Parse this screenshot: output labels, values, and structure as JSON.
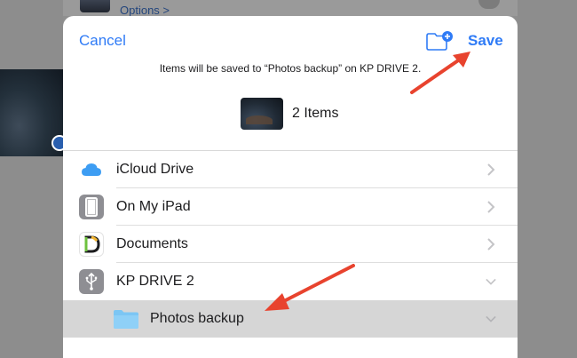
{
  "background": {
    "options_label": "Options >"
  },
  "header": {
    "cancel_label": "Cancel",
    "save_label": "Save",
    "new_folder_icon": "folder-plus-icon"
  },
  "info": {
    "message": "Items will be saved to “Photos backup” on KP DRIVE 2."
  },
  "items": {
    "count_label": "2 Items"
  },
  "locations": [
    {
      "label": "iCloud Drive",
      "icon": "icloud-icon",
      "disclosure": "chevron-right"
    },
    {
      "label": "On My iPad",
      "icon": "ipad-icon",
      "disclosure": "chevron-right"
    },
    {
      "label": "Documents",
      "icon": "documents-app-icon",
      "disclosure": "chevron-right"
    },
    {
      "label": "KP DRIVE 2",
      "icon": "usb-icon",
      "disclosure": "chevron-down"
    },
    {
      "label": "Photos backup",
      "icon": "folder-icon",
      "disclosure": "chevron-down",
      "selected": true
    }
  ],
  "colors": {
    "accent": "#2f7bf6",
    "annotation_arrow": "#e8432e",
    "selected_row": "#d6d6d6",
    "folder": "#7cc6f4"
  }
}
